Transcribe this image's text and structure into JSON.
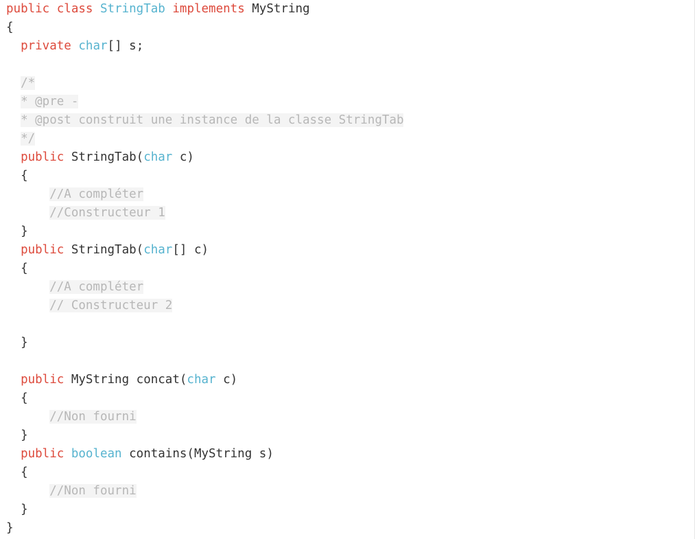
{
  "colors": {
    "keyword": "#dd4a3c",
    "type": "#56b3cf",
    "text": "#333333",
    "comment": "#b7b7b7",
    "comment_background": "#f4f4f4",
    "background": "#ffffff"
  },
  "code": {
    "l1": [
      "public",
      " ",
      "class",
      " ",
      "StringTab",
      " ",
      "implements",
      " MyString"
    ],
    "l2": [
      "{"
    ],
    "l3": [
      "  ",
      "private",
      " ",
      "char",
      "[] s;"
    ],
    "l5": [
      "  ",
      "/*"
    ],
    "l6": [
      "  ",
      "* @pre -"
    ],
    "l7": [
      "  ",
      "* @post construit une instance de la classe StringTab"
    ],
    "l8": [
      "  ",
      "*/"
    ],
    "l9": [
      "  ",
      "public",
      " StringTab(",
      "char",
      " c)"
    ],
    "l10": [
      "  {"
    ],
    "l11": [
      "      ",
      "//A compléter"
    ],
    "l12": [
      "      ",
      "//Constructeur 1"
    ],
    "l13": [
      "  }"
    ],
    "l14": [
      "  ",
      "public",
      " StringTab(",
      "char",
      "[] c)"
    ],
    "l15": [
      "  {"
    ],
    "l16": [
      "      ",
      "//A compléter"
    ],
    "l17": [
      "      ",
      "// Constructeur 2"
    ],
    "l19": [
      "  }"
    ],
    "l21": [
      "  ",
      "public",
      " MyString concat(",
      "char",
      " c)"
    ],
    "l22": [
      "  {"
    ],
    "l23": [
      "      ",
      "//Non fourni"
    ],
    "l24": [
      "  }"
    ],
    "l25": [
      "  ",
      "public",
      " ",
      "boolean",
      " contains(MyString s)"
    ],
    "l26": [
      "  {"
    ],
    "l27": [
      "      ",
      "//Non fourni"
    ],
    "l28": [
      "  }"
    ],
    "l29": [
      "}"
    ]
  }
}
